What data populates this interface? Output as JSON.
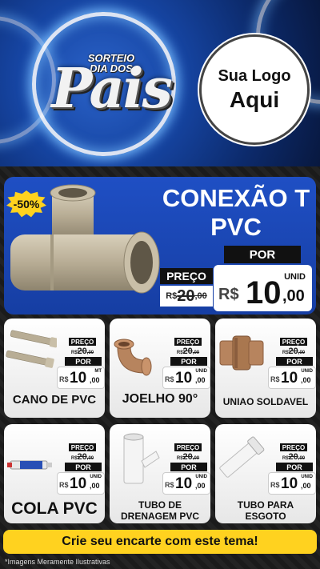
{
  "header": {
    "logo_top": "SORTEIO\nDIA DOS",
    "logo_main": "Pais",
    "brand_line1": "Sua Logo",
    "brand_line2": "Aqui"
  },
  "featured": {
    "badge": "-50%",
    "title": "CONEXÃO T PVC",
    "preco_label": "PREÇO",
    "por_label": "POR",
    "unit": "UNID",
    "currency": "R$",
    "old_value": "20",
    "old_cents": ",00",
    "new_value": "10",
    "new_cents": ",00"
  },
  "price_labels": {
    "preco": "PREÇO",
    "por": "POR",
    "currency": "R$",
    "old_value": "20",
    "old_cents": ",00",
    "new_value": "10",
    "new_cents": ",00"
  },
  "products": [
    {
      "name": "CANO DE PVC",
      "unit": "MT"
    },
    {
      "name": "JOELHO 90°",
      "unit": "UNID"
    },
    {
      "name": "UNIAO SOLDAVEL",
      "unit": "UNID"
    },
    {
      "name": "COLA PVC",
      "unit": "UNID"
    },
    {
      "name": "TUBO DE DRENAGEM PVC",
      "unit": "UNID"
    },
    {
      "name": "TUBO PARA ESGOTO",
      "unit": "UNID"
    }
  ],
  "cta": "Crie seu encarte com este tema!",
  "footnote": "*Imagens Meramente Ilustrativas",
  "colors": {
    "header_blue": "#1645a3",
    "featured_blue": "#1f4fc4",
    "accent_yellow": "#ffd21f",
    "pvc_tan": "#b8ad95",
    "copper_brown": "#b7845e"
  }
}
